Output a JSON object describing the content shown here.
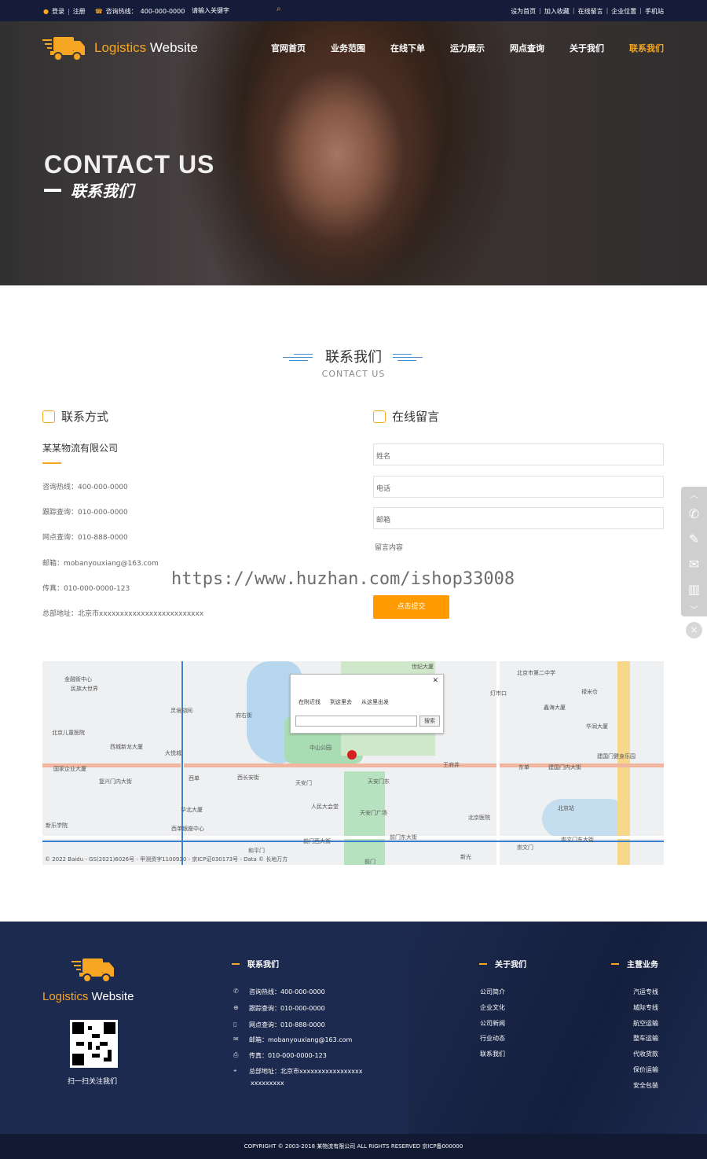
{
  "topbar": {
    "login": "登录",
    "register": "注册",
    "hotline_label": "咨询热线：",
    "hotline": "400-000-0000",
    "search_placeholder": "请输入关键字",
    "links": [
      "设为首页",
      "加入收藏",
      "在线留言",
      "企业位置",
      "手机站"
    ]
  },
  "brand": {
    "name_orange": "Logistics",
    "name_white": "Website"
  },
  "nav": [
    {
      "label": "官网首页",
      "active": false
    },
    {
      "label": "业务范围",
      "active": false
    },
    {
      "label": "在线下单",
      "active": false
    },
    {
      "label": "运力展示",
      "active": false
    },
    {
      "label": "网点查询",
      "active": false
    },
    {
      "label": "关于我们",
      "active": false
    },
    {
      "label": "联系我们",
      "active": true
    }
  ],
  "banner": {
    "title_en": "CONTACT US",
    "title_cn": "联系我们"
  },
  "section": {
    "title_cn": "联系我们",
    "title_en": "CONTACT US"
  },
  "contact": {
    "heading": "联系方式",
    "company": "某某物流有限公司",
    "rows": [
      "咨询热线：400-000-0000",
      "跟踪查询：010-000-0000",
      "网点查询：010-888-0000",
      "邮箱：mobanyouxiang@163.com",
      "传真：010-000-0000-123",
      "总部地址：北京市xxxxxxxxxxxxxxxxxxxxxxxxx"
    ]
  },
  "form": {
    "heading": "在线留言",
    "name_placeholder": "姓名",
    "phone_placeholder": "电话",
    "email_placeholder": "邮箱",
    "message_placeholder": "留言内容",
    "submit": "点击提交"
  },
  "watermark": "https://www.huzhan.com/ishop33008",
  "map": {
    "popup_tabs": [
      "在附近找",
      "到这里去",
      "从这里出发"
    ],
    "search_button": "搜索",
    "labels": [
      "世纪大厦",
      "北京市第二中学",
      "金融街中心",
      "灵境胡同",
      "府右街",
      "中山公园",
      "灯市口",
      "禄米仓",
      "东单",
      "建国门内大街",
      "西单",
      "西长安街",
      "天安门",
      "天安门东",
      "王府井",
      "复兴门内大街",
      "北京儿童医院",
      "西城新龙大厦",
      "人民大会堂",
      "天安门广场",
      "北京站",
      "北京医院",
      "前门东大街",
      "前门西大街",
      "崇文门东大街",
      "华润大厦",
      "建国门健身乐园",
      "民族大世界",
      "国家企业大厦",
      "华北大厦",
      "西单银座中心",
      "和平门",
      "新光",
      "崇文门",
      "前门",
      "鑫海大厦",
      "新乐学院",
      "大悦城"
    ],
    "copyright": "© 2022 Baidu - GS(2021)6026号 - 甲测资字1100930 - 京ICP证030173号 - Data © 长地万方"
  },
  "footer": {
    "brand_orange": "Logistics",
    "brand_white": "Website",
    "qr_caption": "扫一扫关注我们",
    "contact_heading": "联系我们",
    "contact_rows": [
      {
        "icon": "phone-icon",
        "text": "咨询热线：400-000-0000"
      },
      {
        "icon": "target-icon",
        "text": "跟踪查询：010-000-0000"
      },
      {
        "icon": "mobile-icon",
        "text": "网点查询：010-888-0000"
      },
      {
        "icon": "mail-icon",
        "text": "邮箱：mobanyouxiang@163.com"
      },
      {
        "icon": "fax-icon",
        "text": "传真：010-000-0000-123"
      },
      {
        "icon": "location-icon",
        "text": "总部地址：北京市xxxxxxxxxxxxxxxxx"
      },
      {
        "icon": "",
        "text": "xxxxxxxxx"
      }
    ],
    "about_heading": "关于我们",
    "about_links": [
      "公司简介",
      "企业文化",
      "公司新闻",
      "行业动态",
      "联系我们"
    ],
    "business_heading": "主营业务",
    "business_links": [
      "汽运专线",
      "城际专线",
      "航空运输",
      "整车运输",
      "代收货款",
      "保价运输",
      "安全包装"
    ],
    "copyright": "COPYRIGHT © 2003-2018 某物流有限公司  ALL RIGHTS RESERVED  京ICP备000000"
  },
  "colors": {
    "accent": "#f6a623",
    "button": "#ff9a00",
    "topbar": "#151c3a",
    "footer": "#1d2a4f"
  }
}
